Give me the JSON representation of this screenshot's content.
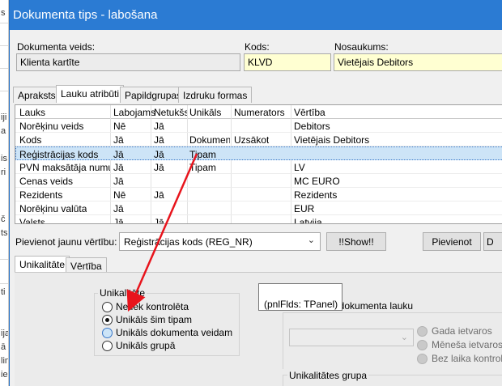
{
  "background_edge": {
    "chars": [
      "s",
      "",
      "iji",
      "a",
      "",
      "is",
      "ri",
      "",
      "č",
      "ts",
      "",
      "",
      "",
      "",
      "ti",
      "",
      "",
      "",
      "ija",
      "",
      "ā",
      "",
      "",
      "",
      "lin",
      "",
      "ie"
    ]
  },
  "window": {
    "title": "Dokumenta tips - labošana"
  },
  "header_fields": {
    "doc_type_label": "Dokumenta veids:",
    "doc_type_value": "Klienta kartīte",
    "code_label": "Kods:",
    "code_value": "KLVD",
    "name_label": "Nosaukums:",
    "name_value": "Vietējais Debitors"
  },
  "tabs": [
    "Apraksts",
    "Lauku atribūti",
    "Papildgrupas",
    "Izdruku formas"
  ],
  "grid": {
    "columns": [
      "Lauks",
      "Labojams",
      "Netukšs",
      "Unikāls",
      "Numerators",
      "Vērtība"
    ],
    "rows": [
      [
        "Norēķinu veids",
        "Nē",
        "Jā",
        "",
        "",
        "Debitors"
      ],
      [
        "Kods",
        "Jā",
        "Jā",
        "Dokument",
        "Uzsākot",
        "Vietējais Debitors"
      ],
      [
        "Reģistrācijas kods",
        "Jā",
        "Jā",
        "Tipam",
        "",
        ""
      ],
      [
        "PVN maksātāja numurs",
        "Jā",
        "Jā",
        "Tipam",
        "",
        "LV"
      ],
      [
        "Cenas veids",
        "Jā",
        "",
        "",
        "",
        "MC EURO"
      ],
      [
        "Rezidents",
        "Nē",
        "Jā",
        "",
        "",
        "Rezidents"
      ],
      [
        "Norēķinu valūta",
        "Jā",
        "",
        "",
        "",
        "EUR"
      ],
      [
        "Valsts",
        "Jā",
        "Jā",
        "",
        "",
        "Latvija"
      ]
    ]
  },
  "add_value": {
    "label": "Pievienot jaunu vērtību:",
    "combo_value": "Reģistrācijas kods (REG_NR)",
    "show_button": "!!Show!!",
    "add_button": "Pievienot",
    "cut_button": "D"
  },
  "subtabs": [
    "Unikalitāte",
    "Vērtība"
  ],
  "uniqueness": {
    "group_title": "Unikalitāte",
    "options": [
      "Netiek kontrolēta",
      "Unikāls šim tipam",
      "Unikāls dokumenta veidam",
      "Unikāls grupā"
    ]
  },
  "right_panel": {
    "check_label": "t dokumenta lauku",
    "period_options": [
      "Gada ietvaros",
      "Mēneša ietvaros",
      "Bez laika kontroles"
    ],
    "group_title": "Unikalitātes grupa"
  },
  "tooltip": "(pnlFlds: TPanel)",
  "annotation_color": "#e8141c"
}
